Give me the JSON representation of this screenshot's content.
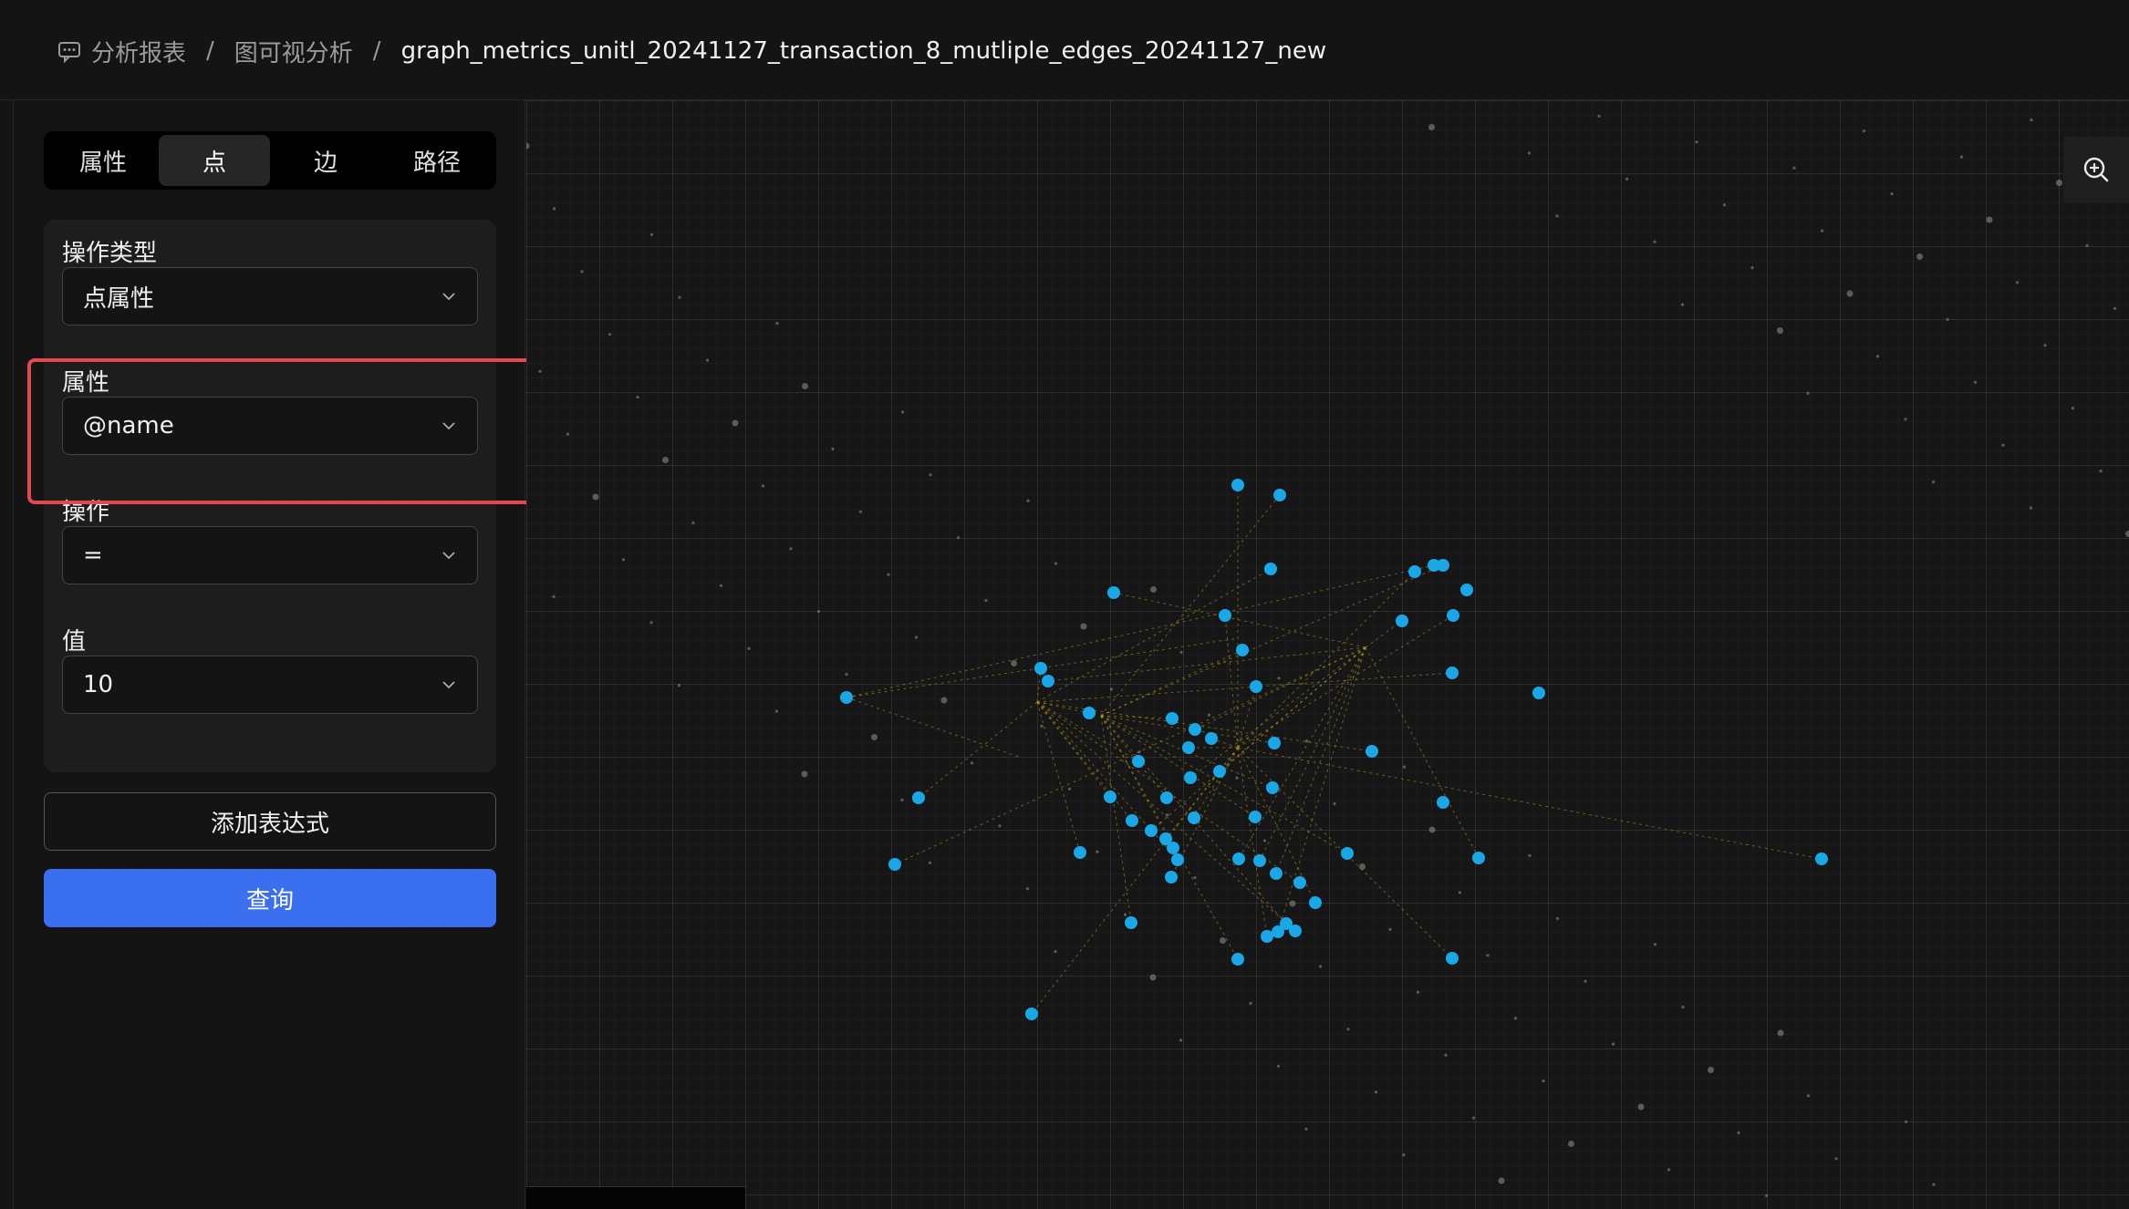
{
  "breadcrumb": {
    "items": [
      "分析报表",
      "图可视分析"
    ],
    "current": "graph_metrics_unitl_20241127_transaction_8_mutliple_edges_20241127_new",
    "separator": "/"
  },
  "tabs": [
    {
      "label": "属性",
      "active": false
    },
    {
      "label": "点",
      "active": true
    },
    {
      "label": "边",
      "active": false
    },
    {
      "label": "路径",
      "active": false
    }
  ],
  "form": {
    "operation_type": {
      "label": "操作类型",
      "value": "点属性"
    },
    "attribute": {
      "label": "属性",
      "value": "@name"
    },
    "operator": {
      "label": "操作",
      "value": "="
    },
    "value": {
      "label": "值",
      "value": "10"
    }
  },
  "buttons": {
    "add_expression": "添加表达式",
    "query": "查询"
  },
  "icons": {
    "breadcrumb": "chat-bubble-icon",
    "zoom": "zoom-in-icon",
    "select_arrow": "chevron-down-icon"
  },
  "colors": {
    "node_highlight": "#1aa7e8",
    "edge": "#b59a1e",
    "query_button": "#3a6ff0",
    "highlight_box": "#e5484d"
  }
}
